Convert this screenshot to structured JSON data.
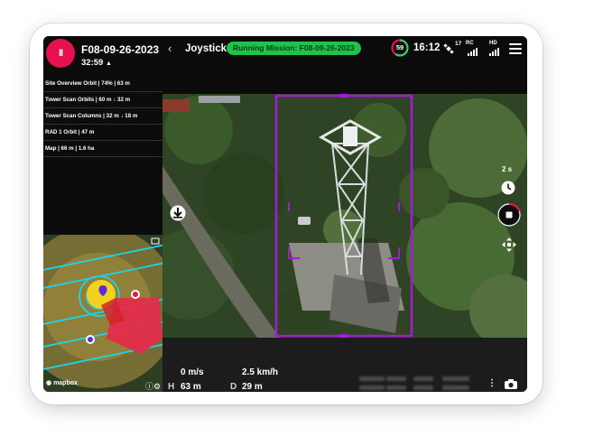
{
  "mission": {
    "name": "F08-09-26-2023",
    "elapsed": "32:59",
    "mode": "Joystick",
    "running_label": "Running Mission: F08-09-26-2023"
  },
  "status": {
    "battery_percent": "59",
    "battery_level": 0.59,
    "clock": "16:12",
    "satellites": "17",
    "rc_label": "RC",
    "hd_label": "HD"
  },
  "steps": [
    {
      "label": "Site Overview Orbit | 74% | 63 m"
    },
    {
      "label": "Tower Scan Orbits | 60 m ↓ 32 m"
    },
    {
      "label": "Tower Scan Columns | 32 m ↓ 18 m"
    },
    {
      "label": "RAD 1 Orbit | 47 m"
    },
    {
      "label": "Map | 66 m | 1.6 ha"
    }
  ],
  "controls": {
    "interval": "2 s"
  },
  "telemetry": {
    "vertical_speed": "0 m/s",
    "horizontal_speed": "2.5 km/h",
    "height_key": "H",
    "height": "63 m",
    "distance_key": "D",
    "distance": "29 m"
  },
  "map": {
    "attribution": "mapbox"
  },
  "colors": {
    "record": "#e8114f",
    "running_pill": "#1ec449",
    "frame": "#a21cd6",
    "battery_ring": "#2fd36a",
    "battery_ring_alert": "#e8114f"
  }
}
